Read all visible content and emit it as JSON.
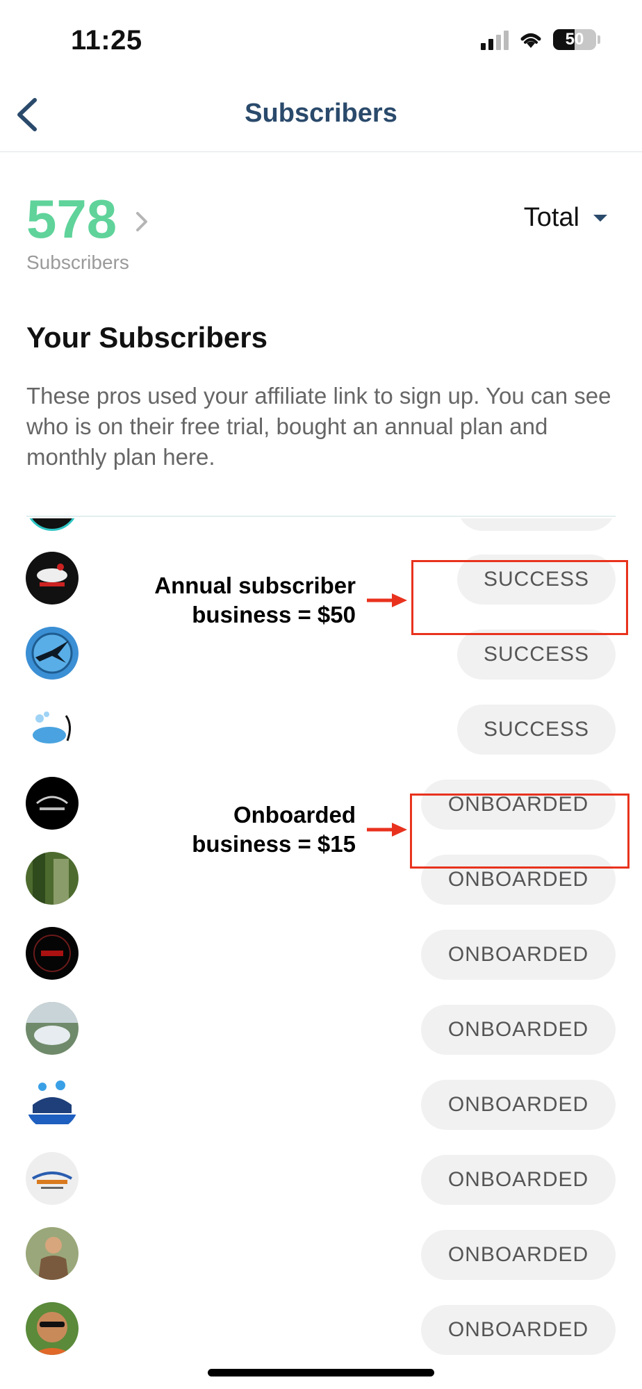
{
  "status_bar": {
    "time": "11:25",
    "battery": "50",
    "battery_level": 0.5
  },
  "nav": {
    "title": "Subscribers",
    "back_icon": "chevron-left-icon"
  },
  "summary": {
    "count": "578",
    "count_label": "Subscribers",
    "filter_label": "Total"
  },
  "section": {
    "title": "Your Subscribers",
    "description": "These pros used your affiliate link to sign up. You can see who is on their free trial, bought an annual plan and monthly plan here."
  },
  "annotations": {
    "annual_line1": "Annual subscriber",
    "annual_line2": "business = $50",
    "onboarded_line1": "Onboarded",
    "onboarded_line2": "business = $15"
  },
  "subscribers": [
    {
      "status": "SUCCESS",
      "avatar": "car-wash-logo-avatar"
    },
    {
      "status": "SUCCESS",
      "avatar": "eagle-logo-avatar"
    },
    {
      "status": "SUCCESS",
      "avatar": "car-splash-logo-avatar"
    },
    {
      "status": "ONBOARDED",
      "avatar": "blk-luxe-logo-avatar"
    },
    {
      "status": "ONBOARDED",
      "avatar": "photo-avatar"
    },
    {
      "status": "ONBOARDED",
      "avatar": "auto-detail-logo-avatar"
    },
    {
      "status": "ONBOARDED",
      "avatar": "boat-photo-avatar"
    },
    {
      "status": "ONBOARDED",
      "avatar": "detail-logo-avatar"
    },
    {
      "status": "ONBOARDED",
      "avatar": "detailing-logo-avatar"
    },
    {
      "status": "ONBOARDED",
      "avatar": "person-photo-avatar"
    },
    {
      "status": "ONBOARDED",
      "avatar": "person-selfie-avatar"
    }
  ],
  "colors": {
    "accent_green": "#5fd39a",
    "nav_title": "#2a4a6b",
    "annotation_red": "#e8321e"
  }
}
